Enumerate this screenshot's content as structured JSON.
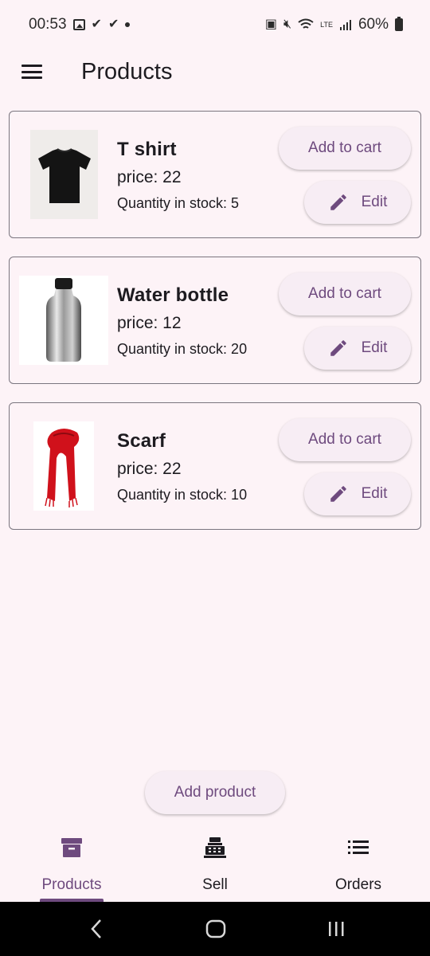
{
  "status_bar": {
    "time": "00:53",
    "battery": "60%",
    "network": "LTE"
  },
  "app_bar": {
    "title": "Products",
    "menu_icon": "menu-icon"
  },
  "products": [
    {
      "name": "T shirt",
      "price": "price: 22",
      "stock": "Quantity in stock: 5",
      "image": "t-shirt-image"
    },
    {
      "name": "Water bottle",
      "price": "price: 12",
      "stock": "Quantity in stock: 20",
      "image": "water-bottle-image"
    },
    {
      "name": "Scarf",
      "price": "price: 22",
      "stock": "Quantity in stock: 10",
      "image": "scarf-image"
    }
  ],
  "buttons": {
    "add_to_cart": "Add to cart",
    "edit": "Edit",
    "add_product": "Add product"
  },
  "bottom_nav": [
    {
      "label": "Products",
      "icon": "archive-box-icon",
      "active": true
    },
    {
      "label": "Sell",
      "icon": "cash-register-icon",
      "active": false
    },
    {
      "label": "Orders",
      "icon": "list-icon",
      "active": false
    }
  ],
  "colors": {
    "background": "#fdf3f7",
    "accent": "#6e4a7e",
    "button_bg": "#f7edf4",
    "card_border": "#7a757f"
  }
}
